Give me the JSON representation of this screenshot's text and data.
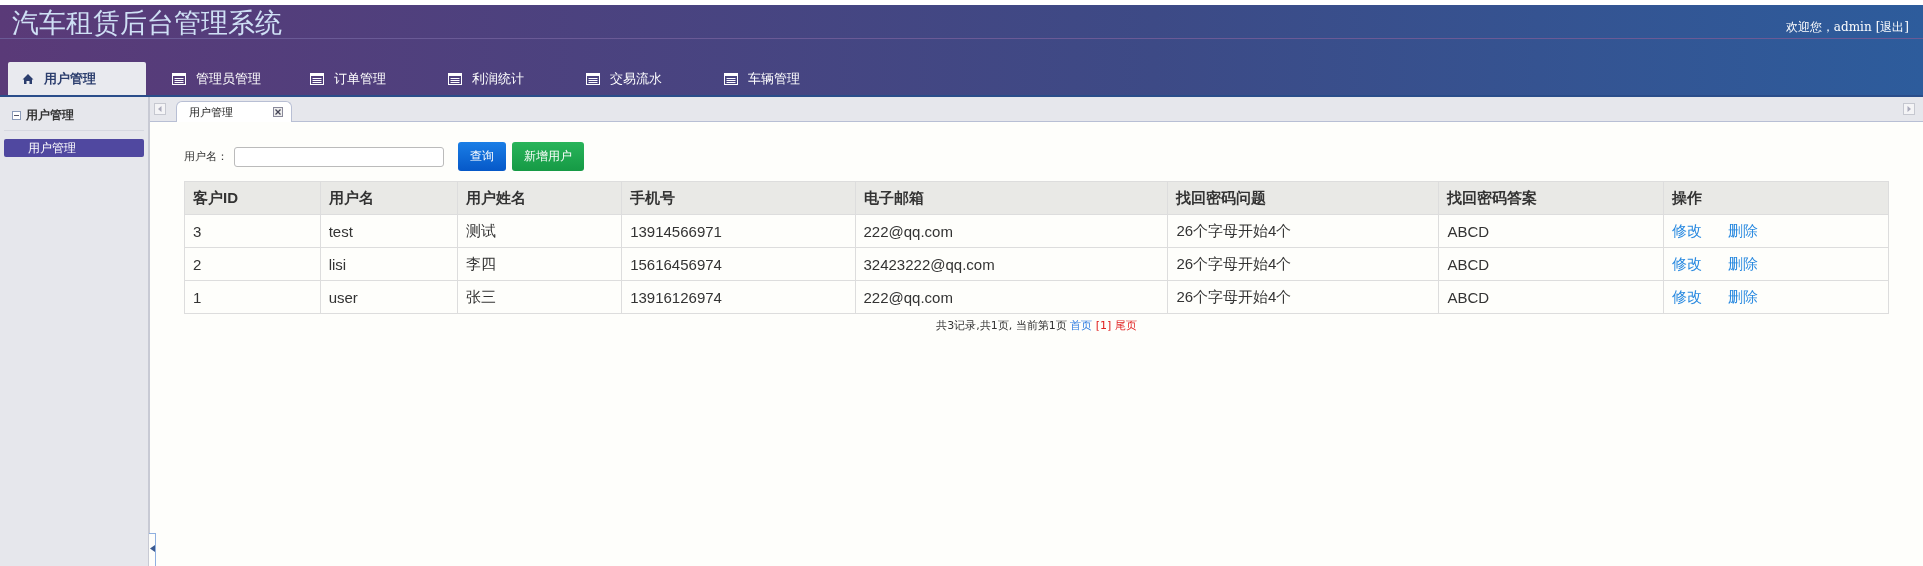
{
  "header": {
    "title": "汽车租赁后台管理系统",
    "greeting": "欢迎您，admin",
    "logout": "[退出]"
  },
  "nav_tabs": [
    {
      "label": "用户管理",
      "selected": true,
      "kind": "home"
    },
    {
      "label": "管理员管理",
      "selected": false,
      "kind": "list"
    },
    {
      "label": "订单管理",
      "selected": false,
      "kind": "list"
    },
    {
      "label": "利润统计",
      "selected": false,
      "kind": "list"
    },
    {
      "label": "交易流水",
      "selected": false,
      "kind": "list"
    },
    {
      "label": "车辆管理",
      "selected": false,
      "kind": "list"
    }
  ],
  "sidebar": {
    "section": "用户管理",
    "expanded": true,
    "items": [
      {
        "label": "用户管理",
        "selected": true
      }
    ]
  },
  "content_tabs": [
    {
      "label": "用户管理",
      "selected": true
    }
  ],
  "search": {
    "label": "用户名：",
    "buttons": [
      {
        "label": "查询",
        "kind": "primary"
      },
      {
        "label": "新增用户",
        "kind": "success"
      }
    ]
  },
  "table": {
    "columns": [
      "客户ID",
      "用户名",
      "用户姓名",
      "手机号",
      "电子邮箱",
      "找回密码问题",
      "找回密码答案",
      "操作"
    ],
    "rows": [
      {
        "cells": [
          "3",
          "test",
          "测试",
          "13914566971",
          "222@qq.com",
          "26个字母开始4个",
          "ABCD"
        ],
        "actions": [
          "修改",
          "删除"
        ]
      },
      {
        "cells": [
          "2",
          "lisi",
          "李四",
          "15616456974",
          "32423222@qq.com",
          "26个字母开始4个",
          "ABCD"
        ],
        "actions": [
          "修改",
          "删除"
        ]
      },
      {
        "cells": [
          "1",
          "user",
          "张三",
          "13916126974",
          "222@qq.com",
          "26个字母开始4个",
          "ABCD"
        ],
        "actions": [
          "修改",
          "删除"
        ]
      }
    ]
  },
  "pagination": {
    "summary": "共3记录,共1页, 当前第1页",
    "first": "首页",
    "current": "[1]",
    "last": "尾页"
  }
}
